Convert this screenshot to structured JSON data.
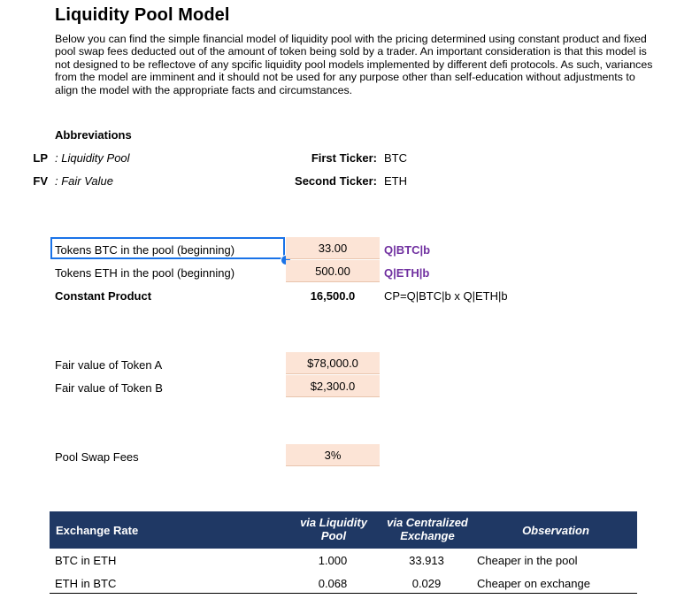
{
  "title": "Liquidity Pool Model",
  "description": "Below you can find the simple financial model of liquidity pool with the pricing determined using constant product and fixed pool swap fees deducted out of the amount of token being sold by a trader. An important consideration is that this model is not designed to be reflectove of any spcific liquidity pool models implemented by different defi protocols. As such, variances from the model are imminent and it should not be used for any purpose other than self-education without adjustments to align the model with the appropriate facts and circumstances.",
  "abbreviations": {
    "heading": "Abbreviations",
    "items": [
      {
        "abbr": "LP",
        "meaning": ": Liquidity Pool"
      },
      {
        "abbr": "FV",
        "meaning": ": Fair Value"
      }
    ]
  },
  "tickers": {
    "first_label": "First Ticker:",
    "first_value": "BTC",
    "second_label": "Second Ticker:",
    "second_value": "ETH"
  },
  "pool": {
    "tokens_a_label": "Tokens BTC in the pool (beginning)",
    "tokens_a_value": "33.00",
    "tokens_a_tag": "Q|BTC|b",
    "tokens_b_label": "Tokens ETH in the pool (beginning)",
    "tokens_b_value": "500.00",
    "tokens_b_tag": "Q|ETH|b",
    "cp_label": "Constant Product",
    "cp_value": "16,500.0",
    "cp_formula": "CP=Q|BTC|b x Q|ETH|b"
  },
  "fair_value": {
    "a_label": "Fair value of Token A",
    "a_value": "$78,000.0",
    "b_label": "Fair value of Token B",
    "b_value": "$2,300.0"
  },
  "fees": {
    "label": "Pool Swap Fees",
    "value": "3%"
  },
  "exchange_table": {
    "headers": {
      "rate": "Exchange Rate",
      "lp_line1": "via Liquidity",
      "lp_line2": "Pool",
      "cex_line1": "via Centralized",
      "cex_line2": "Exchange",
      "observation": "Observation"
    },
    "rows": [
      {
        "label": "BTC in ETH",
        "lp": "1.000",
        "cex": "33.913",
        "observation": "Cheaper in the pool"
      },
      {
        "label": "ETH in BTC",
        "lp": "0.068",
        "cex": "0.029",
        "observation": "Cheaper on exchange"
      }
    ]
  },
  "colors": {
    "header_bg": "#1f3864",
    "input_bg": "#fce4d6",
    "tag_purple": "#7030a0",
    "selection_blue": "#1a73e8"
  }
}
